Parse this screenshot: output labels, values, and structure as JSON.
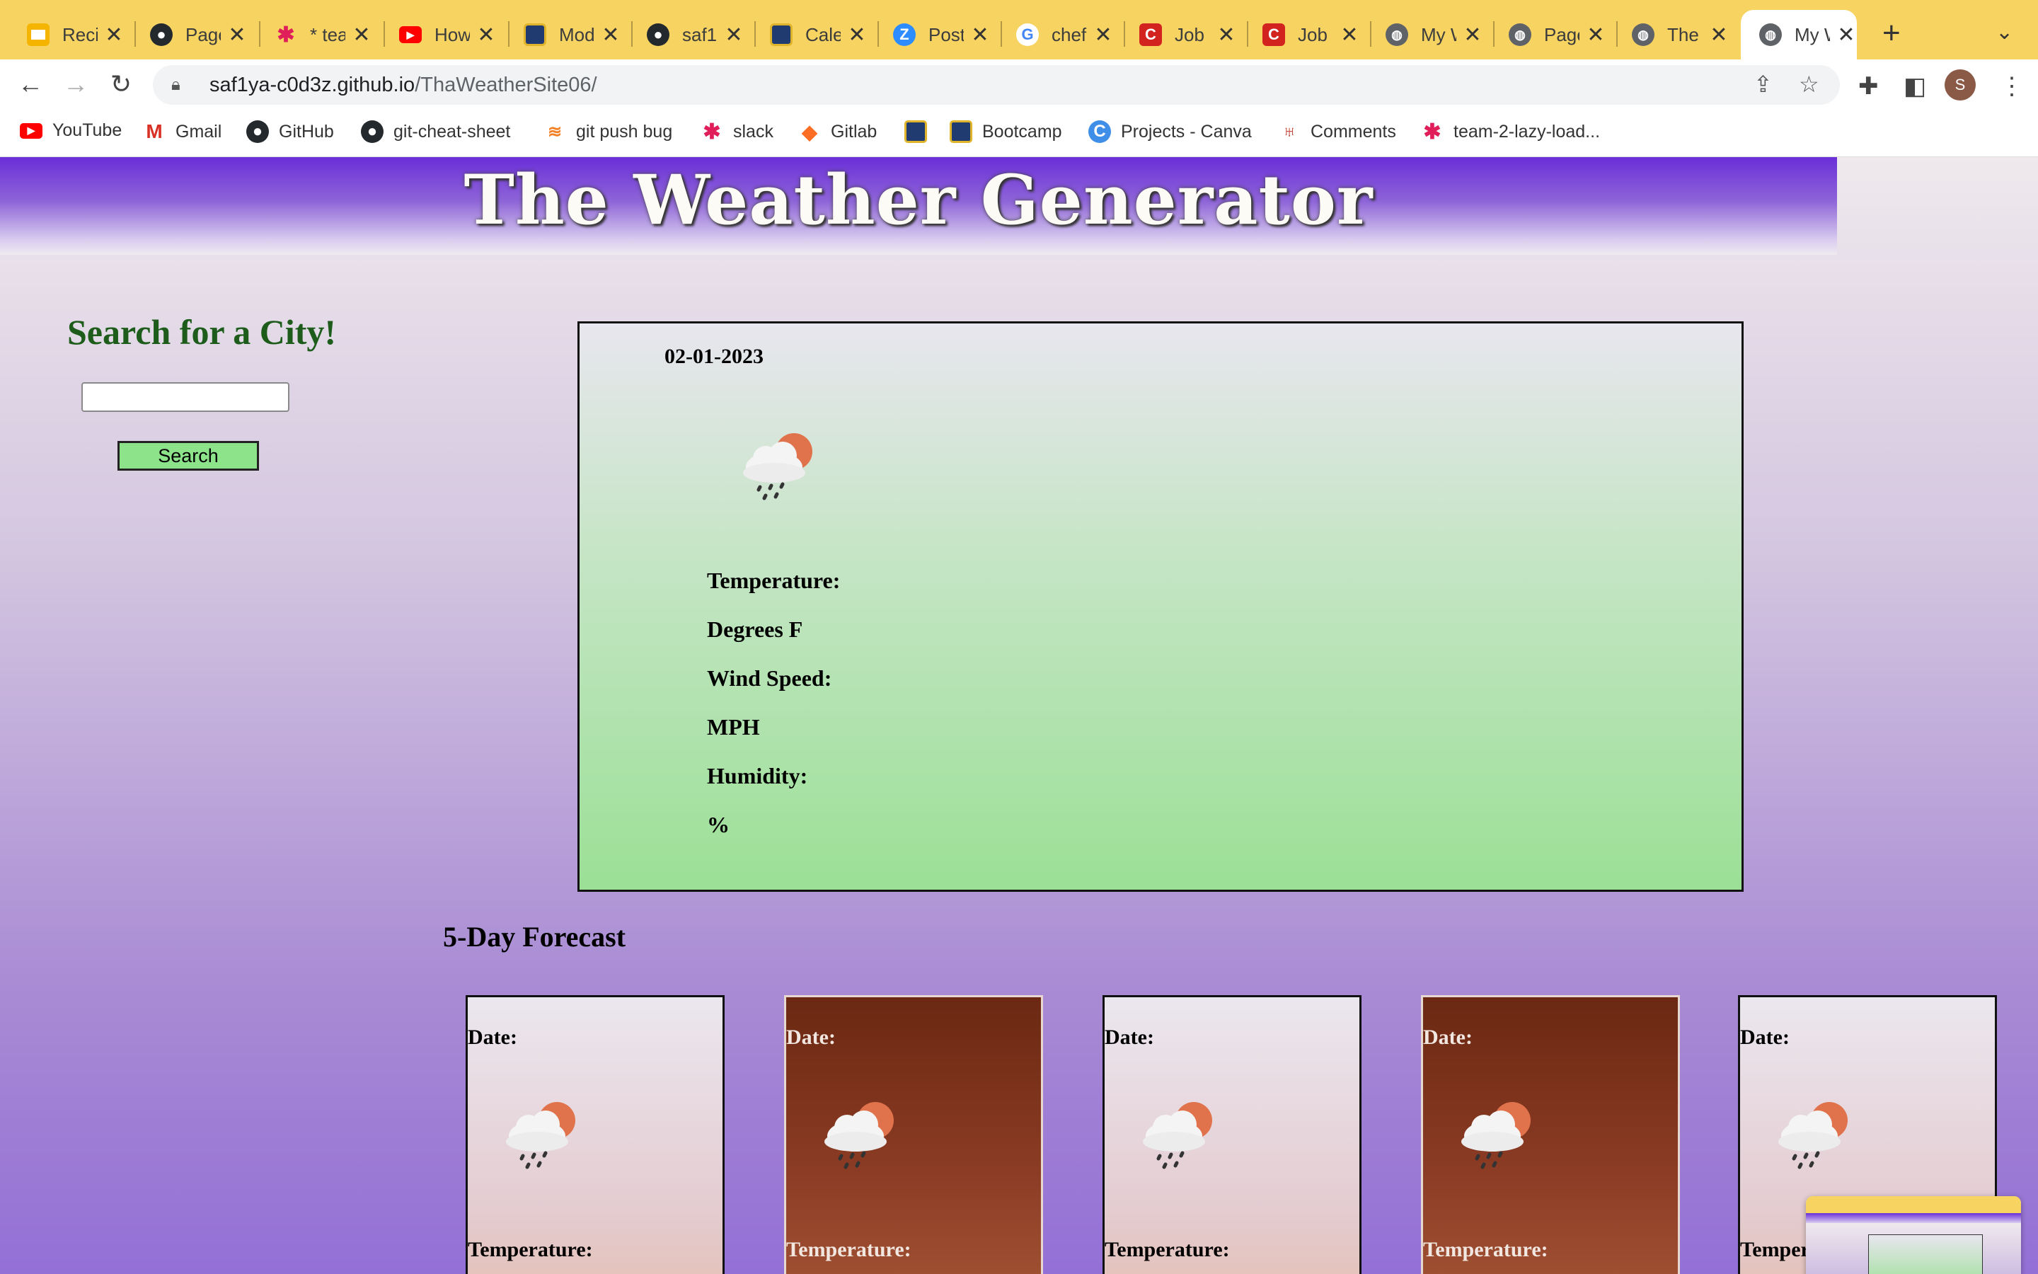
{
  "browser": {
    "tabs": [
      {
        "title": "Reci",
        "icon": "slides-icon",
        "color": "#f4b400"
      },
      {
        "title": "Page",
        "icon": "github-icon",
        "color": "#24292e"
      },
      {
        "title": "* tea",
        "icon": "slack-icon",
        "color": "#e01e5a"
      },
      {
        "title": "How",
        "icon": "youtube-icon",
        "color": "#ff0000"
      },
      {
        "title": "Mod",
        "icon": "bootcamp-icon",
        "color": "#1f3b70"
      },
      {
        "title": "saf1",
        "icon": "github-icon",
        "color": "#24292e"
      },
      {
        "title": "Cale",
        "icon": "bootcamp-icon",
        "color": "#1f3b70"
      },
      {
        "title": "Post",
        "icon": "zoom-icon",
        "color": "#2d8cff"
      },
      {
        "title": "chef",
        "icon": "google-icon",
        "color": "#4285f4"
      },
      {
        "title": "Job",
        "icon": "job-icon",
        "color": "#d2231f"
      },
      {
        "title": "Job",
        "icon": "job-icon",
        "color": "#d2231f"
      },
      {
        "title": "My W",
        "icon": "globe-icon",
        "color": "#5f6368"
      },
      {
        "title": "Page",
        "icon": "globe-icon",
        "color": "#5f6368"
      },
      {
        "title": "The",
        "icon": "globe-icon",
        "color": "#5f6368"
      },
      {
        "title": "My W",
        "icon": "globe-icon",
        "color": "#5f6368"
      }
    ],
    "url_host": "saf1ya-c0d3z.github.io",
    "url_path": "/ThaWeatherSite06/",
    "avatar_letter": "S",
    "bookmarks": [
      {
        "label": "YouTube",
        "icon": "youtube-icon"
      },
      {
        "label": "Gmail",
        "icon": "gmail-icon"
      },
      {
        "label": "GitHub",
        "icon": "github-icon"
      },
      {
        "label": "git-cheat-sheet",
        "icon": "github-icon"
      },
      {
        "label": "git push bug",
        "icon": "stackoverflow-icon"
      },
      {
        "label": "slack",
        "icon": "slack-icon"
      },
      {
        "label": "Gitlab",
        "icon": "gitlab-icon"
      },
      {
        "label": "",
        "icon": "bootcamp-icon"
      },
      {
        "label": "Bootcamp",
        "icon": "bootcamp-icon"
      },
      {
        "label": "Projects - Canva",
        "icon": "canva-icon"
      },
      {
        "label": "Comments",
        "icon": "tower-icon"
      },
      {
        "label": "team-2-lazy-load...",
        "icon": "slack-icon"
      }
    ]
  },
  "page": {
    "title": "The Weather Generator",
    "search_heading": "Search for a City!",
    "search_input_value": "",
    "search_button": "Search",
    "current": {
      "date": "02-01-2023",
      "icon": "cloud-rain-sun-icon",
      "temperature_label": "Temperature:",
      "degrees_label": "Degrees F",
      "wind_label": "Wind Speed:",
      "mph_label": "MPH",
      "humidity_label": "Humidity:",
      "percent_label": "%"
    },
    "forecast_title": "5-Day Forecast",
    "forecast": [
      {
        "date_label": "Date:",
        "temp_label": "Temperature:",
        "style": "light"
      },
      {
        "date_label": "Date:",
        "temp_label": "Temperature:",
        "style": "dark"
      },
      {
        "date_label": "Date:",
        "temp_label": "Temperature:",
        "style": "light"
      },
      {
        "date_label": "Date:",
        "temp_label": "Temperature:",
        "style": "dark"
      },
      {
        "date_label": "Date:",
        "temp_label": "Temperature:",
        "style": "light"
      }
    ]
  },
  "colors": {
    "tabbar": "#f7d462",
    "header_top": "#6a2fd8",
    "search_heading": "#1d5c1a",
    "search_button": "#8de38a",
    "current_bottom": "#9be096",
    "page_bottom": "#9370d6"
  }
}
